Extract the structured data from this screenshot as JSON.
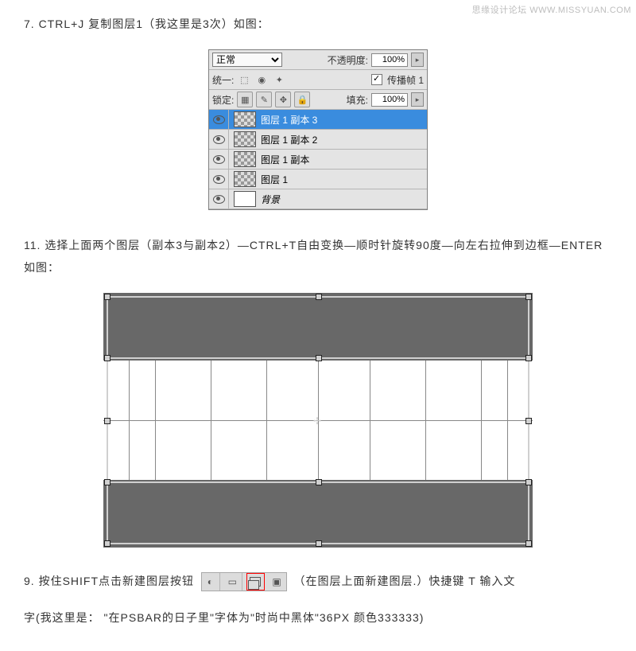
{
  "watermark": "思缘设计论坛   WWW.MISSYUAN.COM",
  "step7": "7. CTRL+J  复制图层1（我这里是3次）如图：",
  "panel": {
    "blend": "正常",
    "opacityLabel": "不透明度:",
    "opacityVal": "100%",
    "unifyLabel": "统一:",
    "propLabel": "传播帧 1",
    "lockLabel": "锁定:",
    "fillLabel": "填充:",
    "fillVal": "100%",
    "layers": [
      {
        "name": "图层 1 副本 3",
        "sel": true
      },
      {
        "name": "图层 1 副本 2"
      },
      {
        "name": "图层 1 副本"
      },
      {
        "name": "图层 1"
      },
      {
        "name": "背景",
        "bg": true
      }
    ]
  },
  "step11": "11. 选择上面两个图层（副本3与副本2）—CTRL+T自由变换—顺时针旋转90度—向左右拉伸到边框—ENTER   如图：",
  "step9a": "9. 按住SHIFT点击新建图层按钮 ",
  "step9b": "（在图层上面新建图层.）快捷键  T  输入文",
  "step9c": "字(我这里是：  \"在PSBAR的日子里\"字体为\"时尚中黑体\"36PX 颜色333333)"
}
